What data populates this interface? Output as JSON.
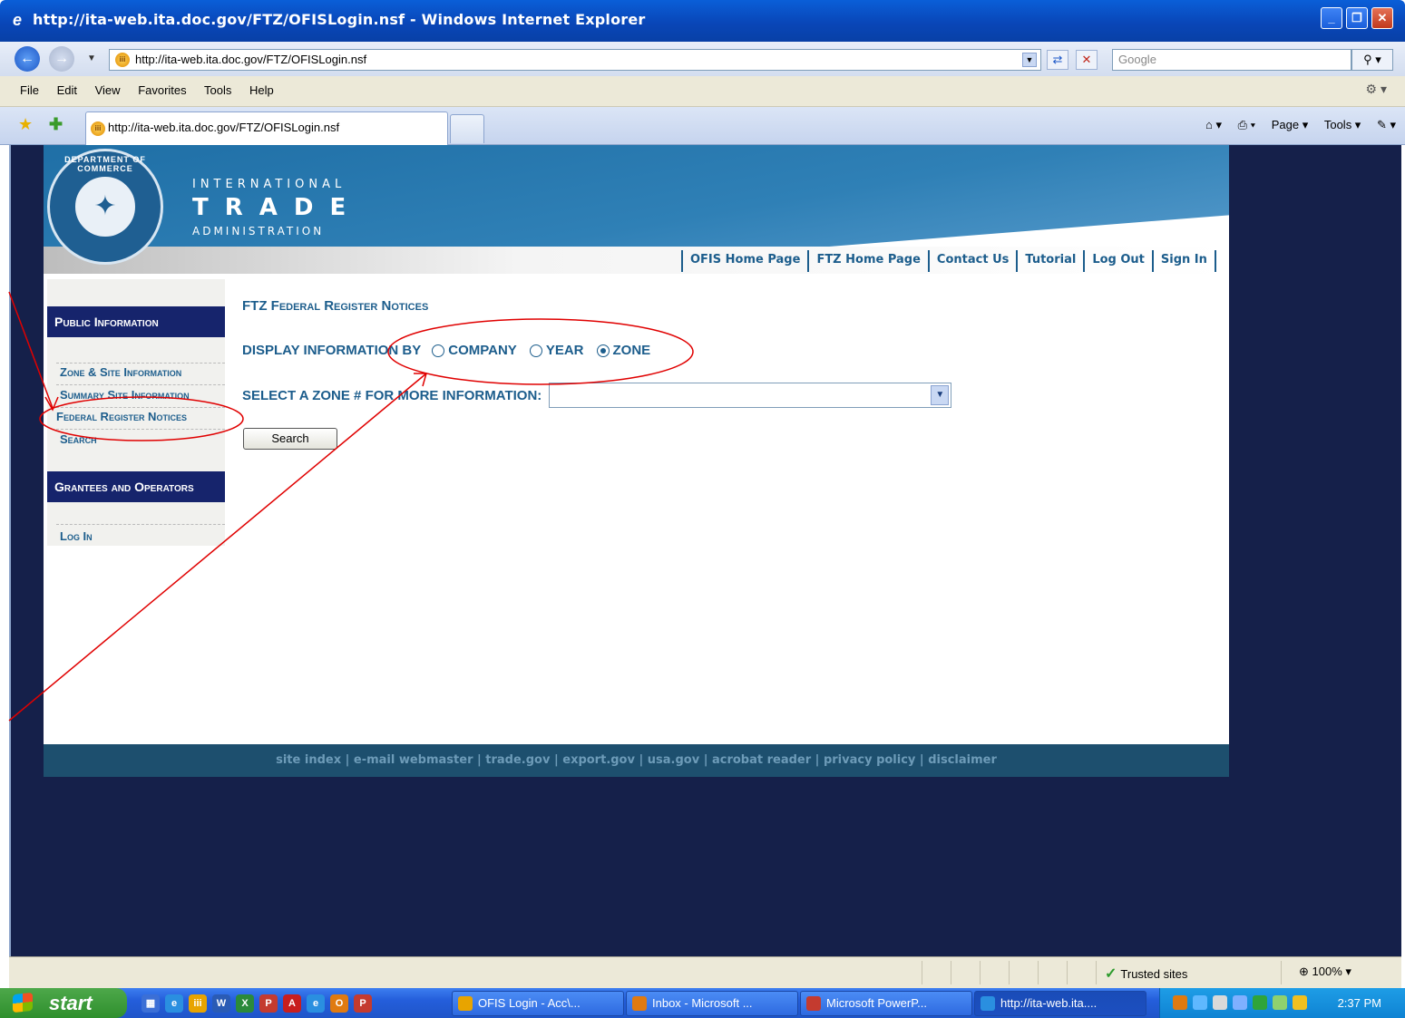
{
  "window": {
    "title": "http://ita-web.ita.doc.gov/FTZ/OFISLogin.nsf - Windows Internet Explorer",
    "minimize": "_",
    "maximize": "❐",
    "close": "✕"
  },
  "address_bar": {
    "url": "http://ita-web.ita.doc.gov/FTZ/OFISLogin.nsf",
    "search_placeholder": "Google"
  },
  "menu": [
    "File",
    "Edit",
    "View",
    "Favorites",
    "Tools",
    "Help"
  ],
  "tab": {
    "label": "http://ita-web.ita.doc.gov/FTZ/OFISLogin.nsf"
  },
  "command_bar": {
    "page": "Page ▾",
    "tools": "Tools ▾"
  },
  "site": {
    "brand_line1": "INTERNATIONAL",
    "brand_line2": "TRADE",
    "brand_line3": "ADMINISTRATION",
    "seal_top": "DEPARTMENT OF COMMERCE",
    "top_nav": [
      "OFIS Home Page",
      "FTZ Home Page",
      "Contact Us",
      "Tutorial",
      "Log Out",
      "Sign In"
    ],
    "sidebar": {
      "public_heading": "Public Information",
      "links": [
        "Zone & Site Information",
        "Summary Site Information",
        "Federal Register Notices",
        "Search"
      ],
      "grantees_heading": "Grantees and Operators",
      "login": "Log In"
    },
    "content": {
      "title": "FTZ Federal Register Notices",
      "display_label": "DISPLAY INFORMATION BY",
      "options": [
        {
          "label": "COMPANY",
          "selected": false
        },
        {
          "label": "YEAR",
          "selected": false
        },
        {
          "label": "ZONE",
          "selected": true
        }
      ],
      "select_label": "SELECT A ZONE # FOR MORE INFORMATION:",
      "select_value": "",
      "search_button": "Search"
    },
    "footer": "site index | e-mail webmaster | trade.gov | export.gov | usa.gov | acrobat reader | privacy policy | disclaimer"
  },
  "status_bar": {
    "zone": "Trusted sites",
    "zoom": "100%"
  },
  "taskbar": {
    "start": "start",
    "tasks": [
      "OFIS Login - Acc\\...",
      "Inbox - Microsoft ...",
      "Microsoft PowerP...",
      "http://ita-web.ita...."
    ],
    "clock": "2:37 PM"
  },
  "colors": {
    "site_link": "#1c5d8c",
    "sidebar_heading_bg": "#16246c",
    "viewport_bg": "#15204a",
    "annotation": "#e00000"
  }
}
